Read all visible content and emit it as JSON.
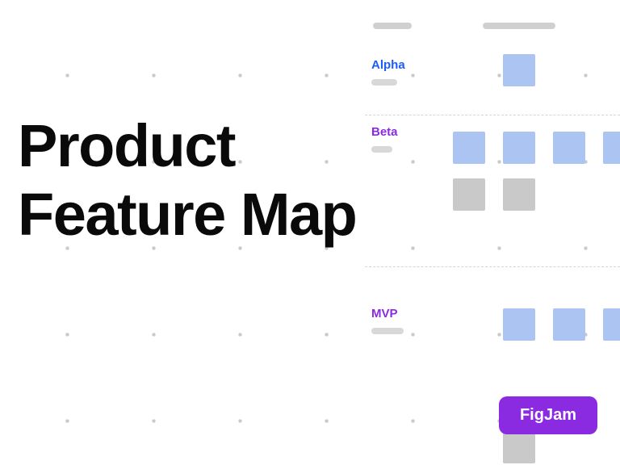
{
  "title_line1": "Product",
  "title_line2": "Feature Map",
  "rows": {
    "alpha": {
      "label": "Alpha",
      "color": "#1a5cff"
    },
    "beta": {
      "label": "Beta",
      "color": "#8a2be2"
    },
    "mvp": {
      "label": "MVP",
      "color": "#8a2be2"
    }
  },
  "badge": {
    "label": "FigJam",
    "bg": "#8a2be2"
  },
  "colors": {
    "card_blue": "#acc4f2",
    "card_grey": "#c9c9c9",
    "header_grey": "#d0d0d0"
  }
}
